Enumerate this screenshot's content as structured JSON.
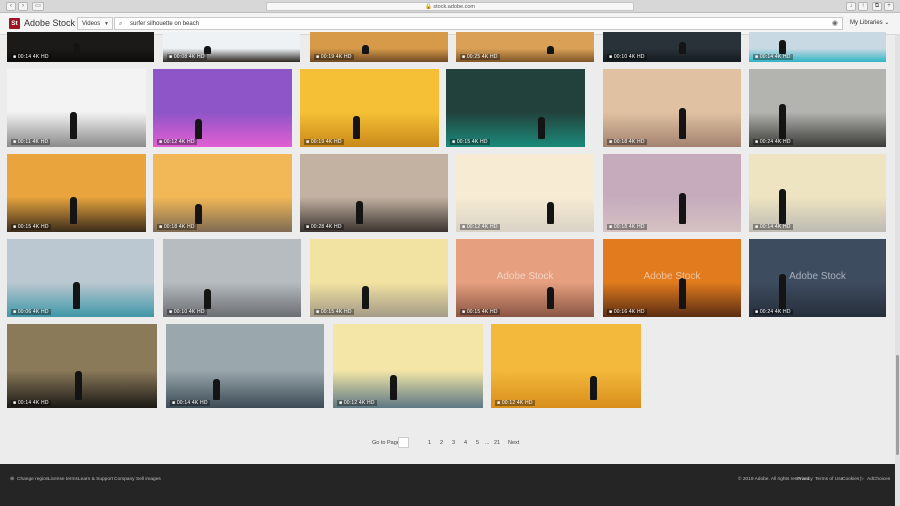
{
  "browser": {
    "url": "stock.adobe.com"
  },
  "header": {
    "logo_badge": "St",
    "logo_text": "Adobe Stock",
    "type_select": "Videos",
    "search_value": "surfer silhouette on beach",
    "my_libraries": "My Libraries"
  },
  "icons": {
    "search": "search-icon",
    "camera": "camera-icon",
    "video": "video-camera-icon"
  },
  "results": [
    {
      "duration": "00:14",
      "badge": "4K HD",
      "sky": "#1c1a18",
      "ground": "#0d0c0b"
    },
    {
      "duration": "00:08",
      "badge": "4K HD",
      "sky": "#eef2f5",
      "ground": "#2b2622"
    },
    {
      "duration": "00:19",
      "badge": "4K HD",
      "sky": "#d69a48",
      "ground": "#6e4a24"
    },
    {
      "duration": "00:25",
      "badge": "4K HD",
      "sky": "#d9a056",
      "ground": "#7d5528"
    },
    {
      "duration": "00:10",
      "badge": "4K HD",
      "sky": "#283238",
      "ground": "#151b1f"
    },
    {
      "duration": "00:14",
      "badge": "4K HD",
      "sky": "#c9d9e3",
      "ground": "#2fb5c4"
    },
    {
      "duration": "00:11",
      "badge": "4K HD",
      "sky": "#f3f3f3",
      "ground": "#8b8b8b"
    },
    {
      "duration": "00:12",
      "badge": "4K HD",
      "sky": "#8d55c7",
      "ground": "#e25fd3"
    },
    {
      "duration": "00:19",
      "badge": "4K HD",
      "sky": "#f5c035",
      "ground": "#c98a1a"
    },
    {
      "duration": "00:15",
      "badge": "4K HD",
      "sky": "#23413c",
      "ground": "#1b8a7a"
    },
    {
      "duration": "00:18",
      "badge": "4K HD",
      "sky": "#e0c2a2",
      "ground": "#a38370"
    },
    {
      "duration": "00:24",
      "badge": "4K HD",
      "sky": "#b3b3b0",
      "ground": "#3b3b38"
    },
    {
      "duration": "00:15",
      "badge": "4K HD",
      "sky": "#e9a43e",
      "ground": "#3b2c1c"
    },
    {
      "duration": "00:18",
      "badge": "4K HD",
      "sky": "#f2b857",
      "ground": "#7f6b53"
    },
    {
      "duration": "00:28",
      "badge": "4K HD",
      "sky": "#c3b2a2",
      "ground": "#3b3430"
    },
    {
      "duration": "00:12",
      "badge": "4K HD",
      "sky": "#f7ecd3",
      "ground": "#d9d2c6"
    },
    {
      "duration": "00:18",
      "badge": "4K HD",
      "sky": "#c6abbd",
      "ground": "#d5c2c2"
    },
    {
      "duration": "00:14",
      "badge": "4K HD",
      "sky": "#eee4c1",
      "ground": "#bdbbb3"
    },
    {
      "duration": "00:06",
      "badge": "4K HD",
      "sky": "#bcc8d1",
      "ground": "#3f97a8"
    },
    {
      "duration": "00:10",
      "badge": "4K HD",
      "sky": "#b6bcc0",
      "ground": "#6b6e72"
    },
    {
      "duration": "00:15",
      "badge": "4K HD",
      "sky": "#f3e3a2",
      "ground": "#a39b86"
    },
    {
      "duration": "00:15",
      "badge": "4K HD",
      "sky": "#e6a080",
      "ground": "#8a5644"
    },
    {
      "duration": "00:16",
      "badge": "4K HD",
      "sky": "#e27b1e",
      "ground": "#5b2d12"
    },
    {
      "duration": "00:24",
      "badge": "4K HD",
      "sky": "#3e4c60",
      "ground": "#262e3a"
    },
    {
      "duration": "00:14",
      "badge": "4K HD",
      "sky": "#8b7a5a",
      "ground": "#1b1916"
    },
    {
      "duration": "00:14",
      "badge": "4K HD",
      "sky": "#9aa7ad",
      "ground": "#3c4b55"
    },
    {
      "duration": "00:12",
      "badge": "4K HD",
      "sky": "#f3e6a7",
      "ground": "#5d7784"
    },
    {
      "duration": "00:12",
      "badge": "4K HD",
      "sky": "#f3b93c",
      "ground": "#d98e1c"
    }
  ],
  "watermark": "Adobe Stock",
  "pagination": {
    "go_to_page": "Go to Page",
    "p1": "1",
    "p2": "2",
    "p3": "3",
    "p4": "4",
    "p5": "5",
    "ellipsis": "...",
    "last": "21",
    "next": "Next"
  },
  "footer": {
    "change_region": "Change region",
    "license_terms": "License terms",
    "learn_support": "Learn & Support",
    "company": "Company",
    "sell_images": "Sell images",
    "copyright": "© 2019 Adobe. All rights reserved.",
    "privacy": "Privacy",
    "terms_of_use": "Terms of Use",
    "cookies": "Cookies",
    "adchoices": "AdChoices"
  }
}
